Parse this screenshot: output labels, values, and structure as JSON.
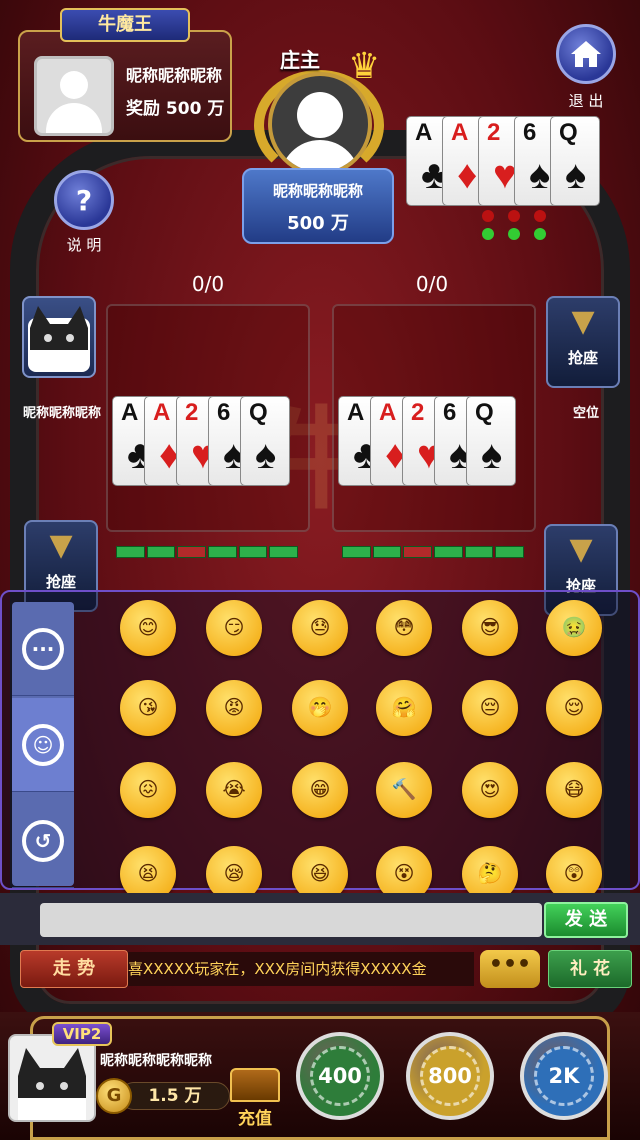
{
  "king": {
    "badge": "牛魔王",
    "name": "昵称昵称昵称",
    "reward": "奖励 500 万"
  },
  "exit": {
    "label": "退 出"
  },
  "help": {
    "label": "说 明",
    "icon": "?"
  },
  "banker": {
    "title": "庄主",
    "name": "昵称昵称昵称",
    "money": "500 万"
  },
  "banker_hand": [
    {
      "rank": "A",
      "suit": "♣",
      "color": "black"
    },
    {
      "rank": "A",
      "suit": "♦",
      "color": "red"
    },
    {
      "rank": "2",
      "suit": "♥",
      "color": "red"
    },
    {
      "rank": "6",
      "suit": "♠",
      "color": "black"
    },
    {
      "rank": "Q",
      "suit": "♠",
      "color": "black"
    }
  ],
  "seats": [
    {
      "score": "0/0"
    },
    {
      "score": "0/0"
    }
  ],
  "left_player": {
    "name": "昵称昵称昵称"
  },
  "right_seat": {
    "grab_label": "抢座",
    "status": "空位"
  },
  "grab_label": "抢座",
  "emoji_tabs": [
    "chat-bubble",
    "smile",
    "history"
  ],
  "emojis": [
    "😊",
    "😏",
    "😓",
    "😳",
    "😎",
    "🤢",
    "😘",
    "😡",
    "🤭",
    "🤗",
    "😔",
    "😌",
    "😖",
    "😭",
    "😁",
    "🔨",
    "😍",
    "😷",
    "😫",
    "😪",
    "😆",
    "😵",
    "🤔",
    "😲"
  ],
  "chat": {
    "placeholder": "",
    "send_label": "发 送"
  },
  "trend_label": "走 势",
  "ticker": "喜XXXXX玩家在，XXX房间内获得XXXXX金",
  "more_label": "•••",
  "gift_label": "礼 花",
  "me": {
    "vip": "VIP2",
    "name": "昵称昵称昵称昵称",
    "coin_icon": "G",
    "balance": "1.5 万"
  },
  "recharge_label": "充值",
  "chips": [
    {
      "label": "400",
      "color": "#2e7d3a"
    },
    {
      "label": "800",
      "color": "#caa12c"
    },
    {
      "label": "2K",
      "color": "#2e6fb8"
    }
  ]
}
